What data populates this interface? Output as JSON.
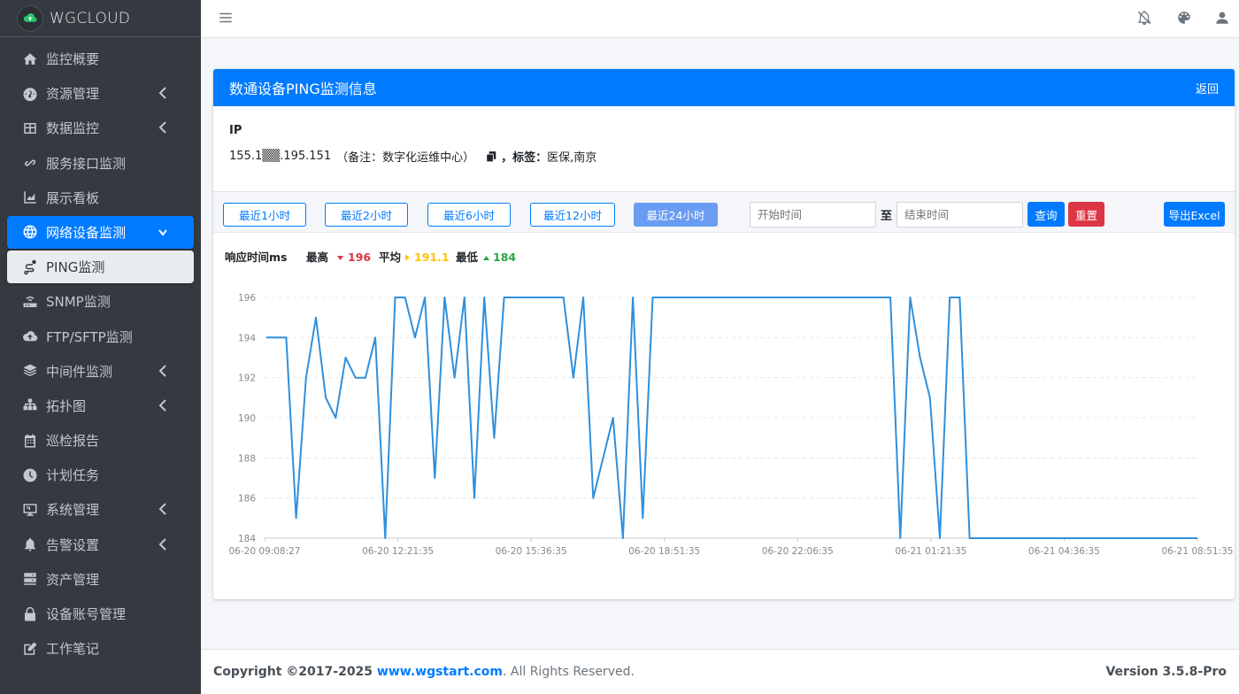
{
  "brand": {
    "name": "WGCLOUD"
  },
  "sidebar": {
    "items": [
      {
        "label": "监控概要",
        "icon": "home-icon",
        "has_arrow": false,
        "state": ""
      },
      {
        "label": "资源管理",
        "icon": "dashboard-icon",
        "has_arrow": true,
        "state": ""
      },
      {
        "label": "数据监控",
        "icon": "table-icon",
        "has_arrow": true,
        "state": ""
      },
      {
        "label": "服务接口监测",
        "icon": "link-icon",
        "has_arrow": false,
        "state": ""
      },
      {
        "label": "展示看板",
        "icon": "chart-area-icon",
        "has_arrow": false,
        "state": ""
      },
      {
        "label": "网络设备监测",
        "icon": "globe-icon",
        "has_arrow": true,
        "state": "active"
      },
      {
        "label": "PING监测",
        "icon": "route-icon",
        "has_arrow": false,
        "state": "sub-active"
      },
      {
        "label": "SNMP监测",
        "icon": "router-icon",
        "has_arrow": false,
        "state": ""
      },
      {
        "label": "FTP/SFTP监测",
        "icon": "cloud-upload-icon",
        "has_arrow": false,
        "state": ""
      },
      {
        "label": "中间件监测",
        "icon": "layers-icon",
        "has_arrow": true,
        "state": ""
      },
      {
        "label": "拓扑图",
        "icon": "sitemap-icon",
        "has_arrow": true,
        "state": ""
      },
      {
        "label": "巡检报告",
        "icon": "calendar-icon",
        "has_arrow": false,
        "state": ""
      },
      {
        "label": "计划任务",
        "icon": "clock-icon",
        "has_arrow": false,
        "state": ""
      },
      {
        "label": "系统管理",
        "icon": "desktop-icon",
        "has_arrow": true,
        "state": ""
      },
      {
        "label": "告警设置",
        "icon": "bell-icon",
        "has_arrow": true,
        "state": ""
      },
      {
        "label": "资产管理",
        "icon": "server-icon",
        "has_arrow": false,
        "state": ""
      },
      {
        "label": "设备账号管理",
        "icon": "lock-icon",
        "has_arrow": false,
        "state": ""
      },
      {
        "label": "工作笔记",
        "icon": "edit-icon",
        "has_arrow": false,
        "state": ""
      }
    ]
  },
  "card": {
    "title": "数通设备PING监测信息",
    "back": "返回",
    "ip_label": "IP",
    "ip_value": "155.1▒▒.195.151",
    "remark": "（备注：数字化运维中心）",
    "tag_label": "，标签：",
    "tag_value": "医保,南京"
  },
  "toolbar": {
    "ranges": [
      "最近1小时",
      "最近2小时",
      "最近6小时",
      "最近12小时",
      "最近24小时"
    ],
    "active_range": 4,
    "start_placeholder": "开始时间",
    "end_placeholder": "结束时间",
    "to": "至",
    "query": "查询",
    "reset": "重置",
    "export": "导出Excel"
  },
  "colors": {
    "primary": "#007bff",
    "danger": "#dc3545",
    "warning": "#ffc107",
    "success": "#28a745",
    "line": "#2f8fdc"
  },
  "chart_data": {
    "type": "line",
    "title": "响应时间ms",
    "stats": {
      "max_label": "最高",
      "max": "196",
      "avg_label": "平均",
      "avg": "191.1",
      "min_label": "最低",
      "min": "184"
    },
    "ylim": [
      184,
      196
    ],
    "yticks": [
      184,
      186,
      188,
      190,
      192,
      194,
      196
    ],
    "xtick_labels": [
      "06-20 09:08:27",
      "06-20 12:21:35",
      "06-20 15:36:35",
      "06-20 18:51:35",
      "06-20 22:06:35",
      "06-21 01:21:35",
      "06-21 04:36:35",
      "06-21 08:51:35"
    ],
    "series": [
      {
        "values": [
          194,
          194,
          194,
          185,
          192,
          195,
          191,
          190,
          193,
          192,
          192,
          194,
          184,
          196,
          196,
          194,
          196,
          187,
          196,
          192,
          196,
          186,
          196,
          189,
          196,
          196,
          196,
          196,
          196,
          196,
          196,
          192,
          196,
          186,
          188,
          190,
          184,
          196,
          185,
          196,
          196,
          196,
          196,
          196,
          196,
          196,
          196,
          196,
          196,
          196,
          196,
          196,
          196,
          196,
          196,
          196,
          196,
          196,
          196,
          196,
          196,
          196,
          196,
          196,
          184,
          196,
          193,
          191,
          184,
          196,
          196,
          184,
          184,
          184,
          184,
          184,
          184,
          184,
          184,
          184,
          184,
          184,
          184,
          184,
          184,
          184,
          184,
          184,
          184,
          184,
          184,
          184,
          184,
          184,
          184
        ]
      }
    ]
  },
  "footer": {
    "copyright": "Copyright ©2017-2025 ",
    "site": "www.wgstart.com",
    "rights": ". All Rights Reserved.",
    "version_label": "Version",
    "version": " 3.5.8-Pro"
  }
}
